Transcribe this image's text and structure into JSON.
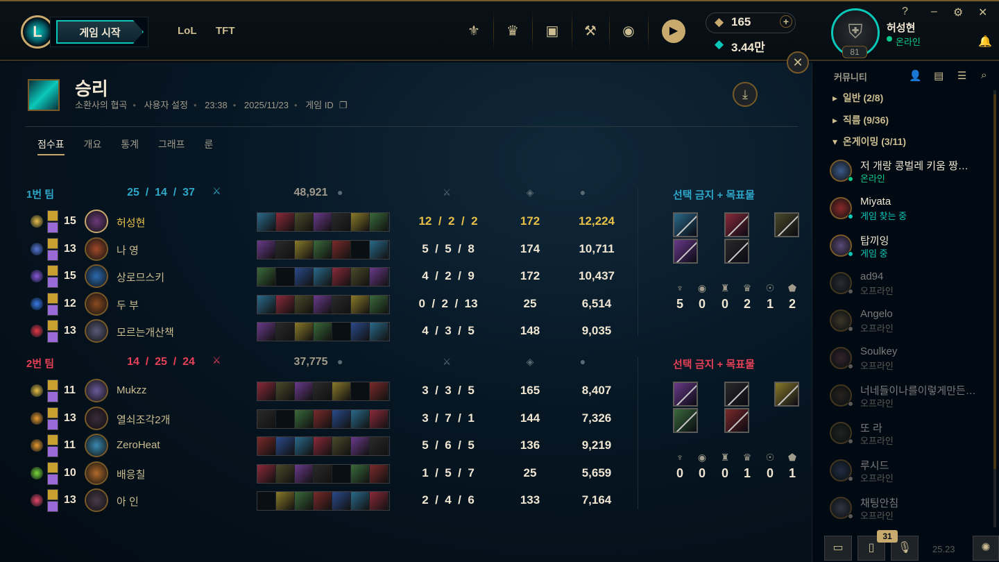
{
  "header": {
    "play_label": "게임 시작",
    "nav": [
      "LoL",
      "TFT"
    ],
    "rp": "165",
    "be": "3.44만",
    "profile_name": "허성현",
    "profile_status": "온라인",
    "profile_level": "81",
    "win_controls": [
      "?",
      "–",
      "⚙",
      "✕"
    ]
  },
  "game": {
    "result": "승리",
    "map": "소환사의 협곡",
    "mode": "사용자 설정",
    "duration": "23:38",
    "date": "2025/11/23",
    "game_id_label": "게임 ID"
  },
  "tabs": [
    "점수표",
    "개요",
    "통계",
    "그래프",
    "룬"
  ],
  "teams": [
    {
      "name": "1번 팀",
      "kda": "25  /  14  /  37",
      "gold": "48,921",
      "color": "#2ea7c9",
      "bans_title": "선택 금지 + 목표물",
      "objectives": [
        "5",
        "0",
        "0",
        "2",
        "1",
        "2"
      ],
      "players": [
        {
          "level": "15",
          "name": "허성현",
          "kda": "12  /  2  /  2",
          "cs": "172",
          "gold": "12,224",
          "me": true,
          "champ_color": "#6b3a7a",
          "rune_color": "#e8c048"
        },
        {
          "level": "13",
          "name": "나 영",
          "kda": "5  /  5  /  8",
          "cs": "174",
          "gold": "10,711",
          "me": false,
          "champ_color": "#a04a2a",
          "rune_color": "#5a7ad8"
        },
        {
          "level": "15",
          "name": "상로므스키",
          "kda": "4  /  2  /  9",
          "cs": "172",
          "gold": "10,437",
          "me": false,
          "champ_color": "#2a6ab0",
          "rune_color": "#8a5ad8"
        },
        {
          "level": "12",
          "name": "두 부",
          "kda": "0  /  2  /  13",
          "cs": "25",
          "gold": "6,514",
          "me": false,
          "champ_color": "#8a4a20",
          "rune_color": "#3a7ae8"
        },
        {
          "level": "13",
          "name": "모르는개산책",
          "kda": "4  /  3  /  5",
          "cs": "148",
          "gold": "9,035",
          "me": false,
          "champ_color": "#5a5a7a",
          "rune_color": "#e83a4a"
        }
      ]
    },
    {
      "name": "2번 팀",
      "kda": "14  /  25  /  24",
      "gold": "37,775",
      "color": "#e84057",
      "bans_title": "선택 금지 + 목표물",
      "objectives": [
        "0",
        "0",
        "0",
        "1",
        "0",
        "1"
      ],
      "players": [
        {
          "level": "11",
          "name": "Mukzz",
          "kda": "3  /  3  /  5",
          "cs": "165",
          "gold": "8,407",
          "me": false,
          "champ_color": "#6a5a9a",
          "rune_color": "#e8c048"
        },
        {
          "level": "13",
          "name": "열쇠조각2개",
          "kda": "3  /  7  /  1",
          "cs": "144",
          "gold": "7,326",
          "me": false,
          "champ_color": "#3a2a3a",
          "rune_color": "#e89a30"
        },
        {
          "level": "11",
          "name": "ZeroHeat",
          "kda": "5  /  6  /  5",
          "cs": "136",
          "gold": "9,219",
          "me": false,
          "champ_color": "#3a8ab0",
          "rune_color": "#e89a30"
        },
        {
          "level": "10",
          "name": "배응칠",
          "kda": "1  /  5  /  7",
          "cs": "25",
          "gold": "5,659",
          "me": false,
          "champ_color": "#b06a2a",
          "rune_color": "#7ad83a"
        },
        {
          "level": "13",
          "name": "아 인",
          "kda": "2  /  4  /  6",
          "cs": "133",
          "gold": "7,164",
          "me": false,
          "champ_color": "#4a3a4a",
          "rune_color": "#e84a6a"
        }
      ]
    }
  ],
  "social": {
    "title": "커뮤니티",
    "groups": [
      "일반 (2/8)",
      "직름 (9/36)",
      "온게이밍 (3/11)"
    ],
    "friends": [
      {
        "name": "저 개랑 콩벌레 키움 짱…",
        "status": "온라인",
        "state": "online"
      },
      {
        "name": "Miyata",
        "status": "게임 찾는 중",
        "state": "ingame"
      },
      {
        "name": "탑끼잉",
        "status": "게임 중",
        "state": "ingame"
      },
      {
        "name": "ad94",
        "status": "오프라인",
        "state": "offline"
      },
      {
        "name": "Angelo",
        "status": "오프라인",
        "state": "offline"
      },
      {
        "name": "Soulkey",
        "status": "오프라인",
        "state": "offline"
      },
      {
        "name": "너네들이나를이렇게만든…",
        "status": "오프라인",
        "state": "offline"
      },
      {
        "name": "또 라",
        "status": "오프라인",
        "state": "offline"
      },
      {
        "name": "루시드",
        "status": "오프라인",
        "state": "offline"
      },
      {
        "name": "채팅안침",
        "status": "오프라인",
        "state": "offline"
      }
    ],
    "badge": "31",
    "version": "25.23"
  }
}
